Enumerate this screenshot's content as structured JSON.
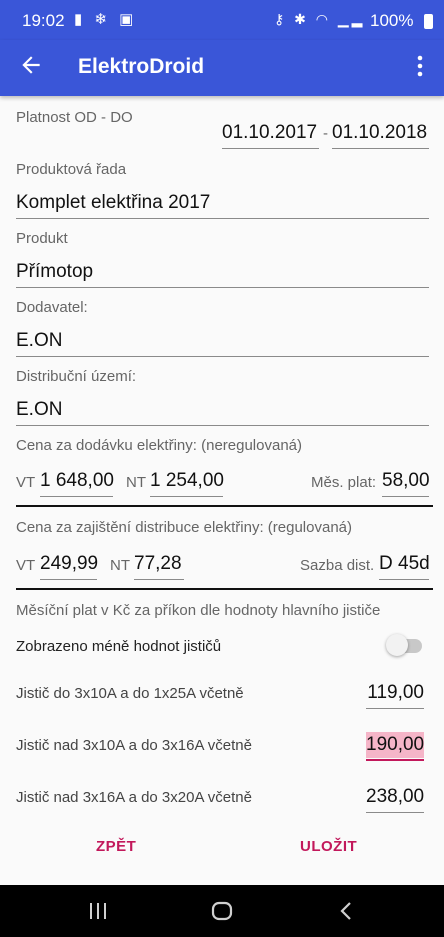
{
  "status": {
    "time": "19:02",
    "battery": "100%"
  },
  "app": {
    "title": "ElektroDroid"
  },
  "validity": {
    "label": "Platnost OD - DO",
    "from": "01.10.2017",
    "sep": "-",
    "to": "01.10.2018"
  },
  "product_line": {
    "label": "Produktová řada",
    "value": "Komplet elektřina 2017"
  },
  "product": {
    "label": "Produkt",
    "value": "Přímotop"
  },
  "supplier": {
    "label": "Dodavatel:",
    "value": "E.ON"
  },
  "area": {
    "label": "Distribuční území:",
    "value": "E.ON"
  },
  "supply_price": {
    "label": "Cena za dodávku elektřiny: (neregulovaná)",
    "vt_label": "VT",
    "vt": "1 648,00",
    "nt_label": "NT",
    "nt": "1 254,00",
    "monthly_label": "Měs. plat:",
    "monthly": "58,00"
  },
  "dist_price": {
    "label": "Cena za zajištění distribuce elektřiny: (regulovaná)",
    "vt_label": "VT",
    "vt": "249,99",
    "nt_label": "NT",
    "nt": "77,28",
    "rate_label": "Sazba dist.",
    "rate": "D 45d"
  },
  "breaker": {
    "heading": "Měsíční plat v Kč za příkon dle hodnoty hlavního jističe",
    "toggle_label": "Zobrazeno méně hodnot jističů",
    "toggle_on": false,
    "rows": [
      {
        "label": "Jistič do 3x10A a do 1x25A včetně",
        "value": "119,00"
      },
      {
        "label": "Jistič nad 3x10A a do 3x16A včetně",
        "value": "190,00"
      },
      {
        "label": "Jistič nad 3x16A a do 3x20A včetně",
        "value": "238,00"
      }
    ]
  },
  "actions": {
    "back": "ZPĚT",
    "save": "ULOŽIT"
  },
  "colors": {
    "primary": "#3a56d8",
    "accent": "#c2185b",
    "highlight": "#f5b5c8"
  }
}
